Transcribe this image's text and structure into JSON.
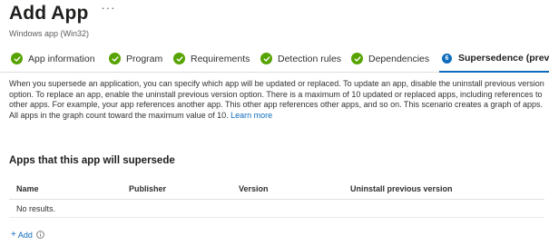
{
  "header": {
    "title": "Add App",
    "more_label": "···",
    "subtitle": "Windows app (Win32)"
  },
  "steps": [
    {
      "label": "App information",
      "status": "complete"
    },
    {
      "label": "Program",
      "status": "complete"
    },
    {
      "label": "Requirements",
      "status": "complete"
    },
    {
      "label": "Detection rules",
      "status": "complete"
    },
    {
      "label": "Dependencies",
      "status": "complete"
    },
    {
      "label": "Supersedence (preview",
      "status": "active",
      "number": "6"
    }
  ],
  "description": {
    "text": "When you supersede an application, you can specify which app will be updated or replaced. To update an app, disable the uninstall previous version option. To replace an app, enable the uninstall previous version option. There is a maximum of 10 updated or replaced apps, including references to other apps. For example, your app references another app. This other app references other apps, and so on. This scenario creates a graph of apps. All apps in the graph count toward the maximum value of 10.",
    "link": "Learn more"
  },
  "section": {
    "title": "Apps that this app will supersede"
  },
  "table": {
    "columns": [
      "Name",
      "Publisher",
      "Version",
      "Uninstall previous version"
    ],
    "empty_text": "No results."
  },
  "add": {
    "plus": "+",
    "label": "Add"
  },
  "colors": {
    "complete": "#57a300",
    "accent": "#0f6cbd",
    "text": "#323130"
  },
  "icons": {
    "step_complete": "checkmark-circle-icon",
    "info": "info-icon"
  }
}
